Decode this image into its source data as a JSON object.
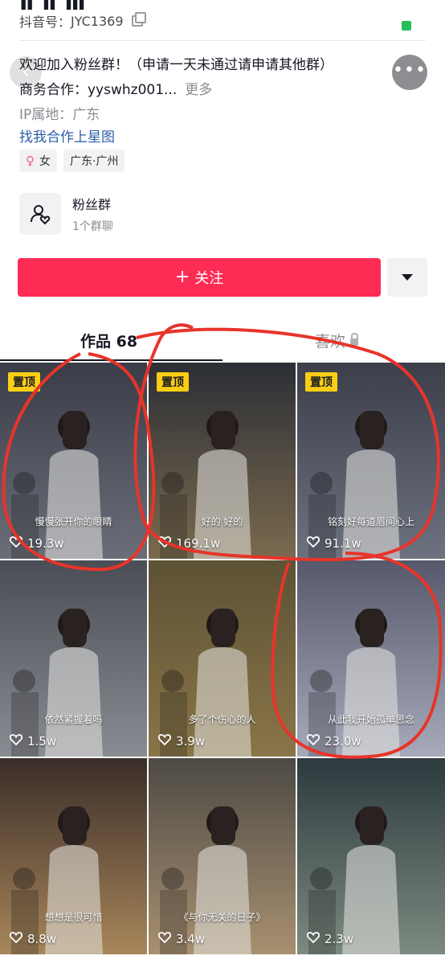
{
  "profile": {
    "name_cut": "Ⅱ Ⅱ Ⅲ",
    "account_label": "抖音号：",
    "account_id": "JYC1369",
    "bio": "欢迎加入粉丝群！（申请一天未通过请申请其他群）",
    "business_prefix": "商务合作：yyswhz001...",
    "business_more": "更多",
    "ip": "IP属地：广东",
    "xingtu_link": "找我合作上星图",
    "tags": {
      "gender": "女",
      "location": "广东·广州"
    }
  },
  "fans_group": {
    "title": "粉丝群",
    "subtitle": "1个群聊"
  },
  "actions": {
    "follow": "关注"
  },
  "tabs": {
    "works": "作品 68",
    "likes": "喜欢"
  },
  "pinned_label": "置顶",
  "videos": [
    {
      "pinned": true,
      "caption": "慢慢张开你的眼睛",
      "likes": "19.3w"
    },
    {
      "pinned": true,
      "caption": "好的 好的",
      "likes": "169.1w"
    },
    {
      "pinned": true,
      "caption": "铭刻好每道眉间心上",
      "likes": "91.1w"
    },
    {
      "pinned": false,
      "caption": "依然紧握着吗",
      "likes": "1.5w"
    },
    {
      "pinned": false,
      "caption": "多了个伤心的人",
      "likes": "3.9w"
    },
    {
      "pinned": false,
      "caption": "从此我开始孤单思念",
      "likes": "23.0w"
    },
    {
      "pinned": false,
      "caption": "想想是很可惜",
      "likes": "8.8w"
    },
    {
      "pinned": false,
      "caption": "《与你无关的日子》",
      "likes": "3.4w"
    },
    {
      "pinned": false,
      "caption": "",
      "likes": "2.3w"
    }
  ],
  "colors": {
    "accent": "#fe2c55",
    "link": "#2a5ea8",
    "pin_badge": "#face15",
    "annotation": "#e8342a"
  }
}
